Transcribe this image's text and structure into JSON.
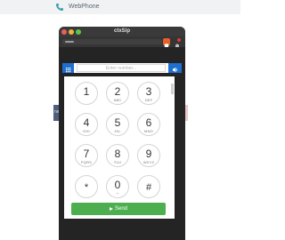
{
  "page_header": {
    "title": "WebPhone"
  },
  "background": {
    "left_strip_text": "ne"
  },
  "window": {
    "title": "ctxSip"
  },
  "dialer": {
    "number_placeholder": "Enter number...",
    "keys": [
      {
        "digit": "1",
        "letters": ""
      },
      {
        "digit": "2",
        "letters": "ABC"
      },
      {
        "digit": "3",
        "letters": "DEF"
      },
      {
        "digit": "4",
        "letters": "GHI"
      },
      {
        "digit": "5",
        "letters": "JKL"
      },
      {
        "digit": "6",
        "letters": "MNO"
      },
      {
        "digit": "7",
        "letters": "PQRS"
      },
      {
        "digit": "8",
        "letters": "TUV"
      },
      {
        "digit": "9",
        "letters": "WXYZ"
      },
      {
        "digit": "*",
        "letters": ""
      },
      {
        "digit": "0",
        "letters": "+"
      },
      {
        "digit": "#",
        "letters": ""
      }
    ],
    "send_label": "Send"
  },
  "colors": {
    "primary_blue": "#1f6fcf",
    "send_green": "#4cae4f",
    "brave_orange": "#e95f2b"
  },
  "icons": {
    "app": "phone-icon",
    "grid": "grid-icon",
    "speaker": "volume-icon",
    "send": "play-icon",
    "shield": "brave-shield-icon",
    "notification": "bell-icon"
  }
}
